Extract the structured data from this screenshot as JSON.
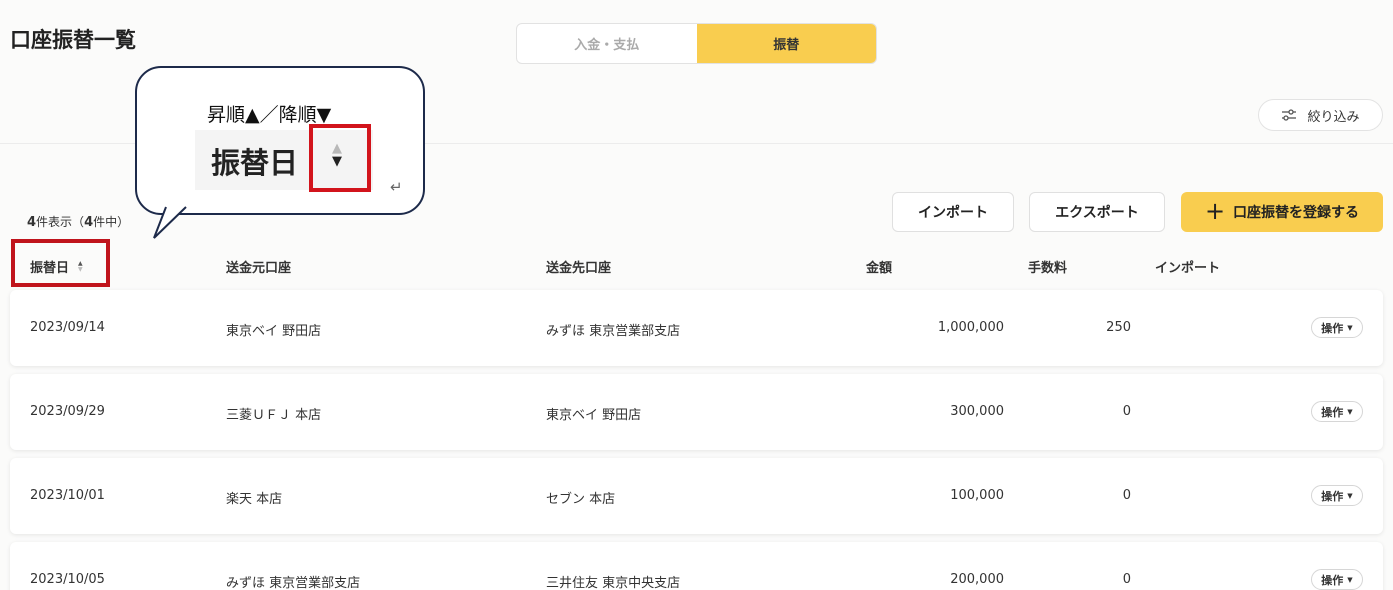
{
  "page": {
    "title": "口座振替一覧"
  },
  "tabs": [
    {
      "label": "入金・支払",
      "active": false
    },
    {
      "label": "振替",
      "active": true
    }
  ],
  "filter": {
    "label": "絞り込み",
    "icon": "filter-sliders-icon"
  },
  "summary": {
    "shown": "4",
    "shown_suffix": "件表示（",
    "total": "4",
    "total_suffix": "件中）"
  },
  "actions": {
    "import_label": "インポート",
    "export_label": "エクスポート",
    "register_label": "口座振替を登録する",
    "register_icon": "plus-icon"
  },
  "table": {
    "columns": [
      "振替日",
      "送金元口座",
      "送金先口座",
      "金額",
      "手数料",
      "インポート"
    ],
    "sort_icon": "sort-arrows-icon",
    "rows": [
      {
        "date": "2023/09/14",
        "from": "東京ベイ 野田店",
        "to": "みずほ 東京営業部支店",
        "amount": "1,000,000",
        "fee": "250",
        "op": "操作"
      },
      {
        "date": "2023/09/29",
        "from": "三菱ＵＦＪ 本店",
        "to": "東京ベイ 野田店",
        "amount": "300,000",
        "fee": "0",
        "op": "操作"
      },
      {
        "date": "2023/10/01",
        "from": "楽天 本店",
        "to": "セブン 本店",
        "amount": "100,000",
        "fee": "0",
        "op": "操作"
      },
      {
        "date": "2023/10/05",
        "from": "みずほ 東京営業部支店",
        "to": "三井住友 東京中央支店",
        "amount": "200,000",
        "fee": "0",
        "op": "操作"
      }
    ]
  },
  "annotation": {
    "caption": "昇順▲／降順▼",
    "header_text": "振替日",
    "enter_glyph": "↵",
    "highlight_color": "#d2141c"
  },
  "colors": {
    "accent": "#f9cd4f",
    "bubble_border": "#1d2a4a"
  }
}
